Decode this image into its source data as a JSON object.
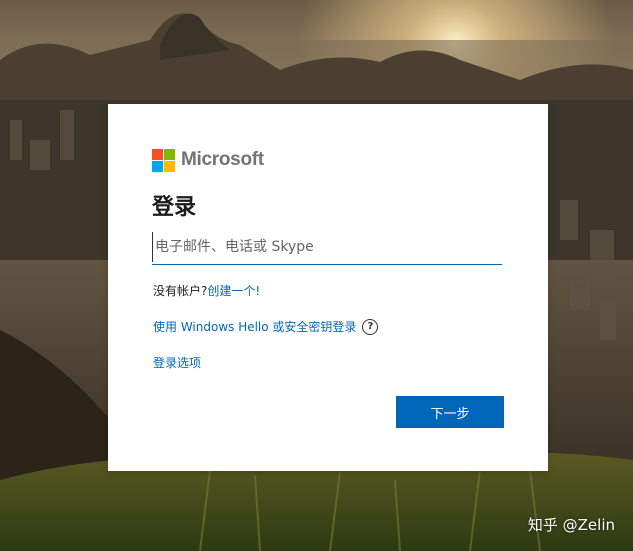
{
  "brand": {
    "name": "Microsoft",
    "logo_colors": [
      "#f25022",
      "#7fba00",
      "#00a4ef",
      "#ffb900"
    ]
  },
  "signin": {
    "title": "登录",
    "input_placeholder": "电子邮件、电话或 Skype",
    "no_account_text": "没有帐户?",
    "create_link": "创建一个!",
    "windows_hello_link": "使用 Windows Hello 或安全密钥登录",
    "help_icon": "?",
    "signin_options_link": "登录选项",
    "next_button": "下一步"
  },
  "watermark": "知乎 @Zelin",
  "colors": {
    "accent": "#0067b8",
    "card": "#ffffff"
  }
}
